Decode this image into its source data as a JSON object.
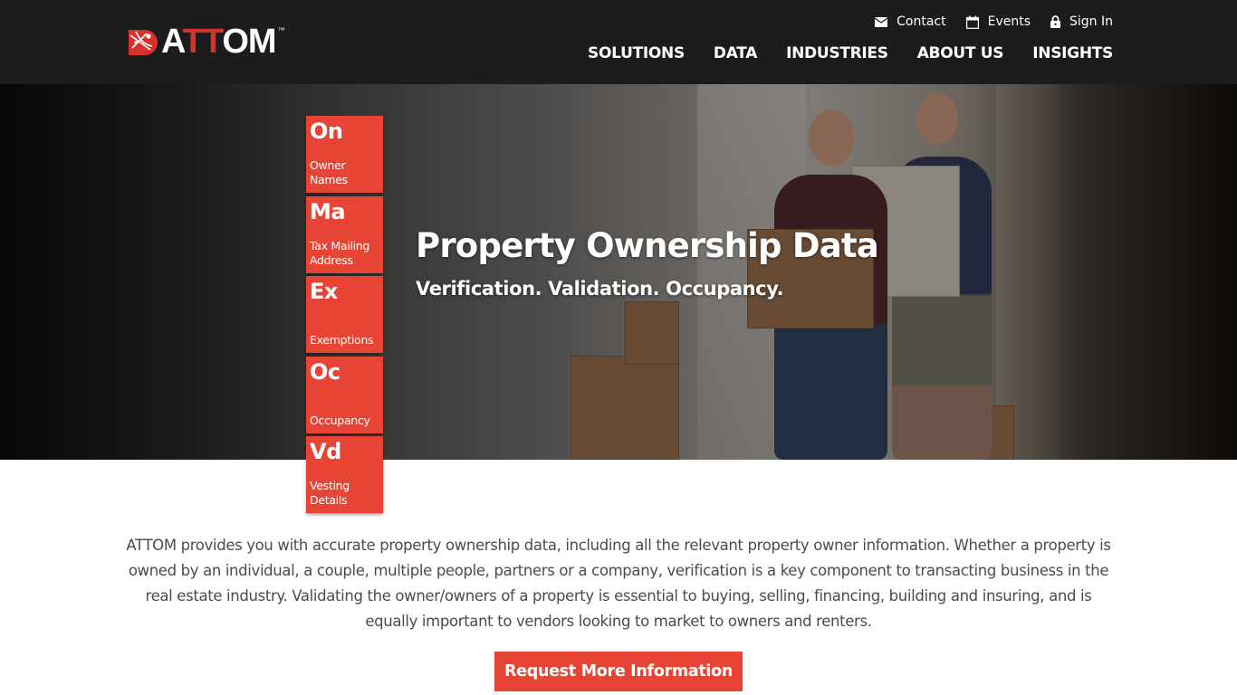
{
  "brand": {
    "name_prefix": "A",
    "name_red": "TT",
    "name_suffix": "OM",
    "trademark": "™",
    "accent_color": "#e84435"
  },
  "utility_nav": [
    {
      "icon": "envelope-icon",
      "label": "Contact"
    },
    {
      "icon": "calendar-icon",
      "label": "Events"
    },
    {
      "icon": "lock-icon",
      "label": "Sign In"
    }
  ],
  "main_nav": [
    {
      "label": "SOLUTIONS"
    },
    {
      "label": "DATA"
    },
    {
      "label": "INDUSTRIES"
    },
    {
      "label": "ABOUT US"
    },
    {
      "label": "INSIGHTS"
    }
  ],
  "hero": {
    "title": "Property Ownership Data",
    "subtitle": "Verification. Validation. Occupancy."
  },
  "tiles": [
    {
      "symbol": "On",
      "label": "Owner Names"
    },
    {
      "symbol": "Ma",
      "label": "Tax Mailing Address"
    },
    {
      "symbol": "Ex",
      "label": "Exemptions"
    },
    {
      "symbol": "Oc",
      "label": "Occupancy"
    },
    {
      "symbol": "Vd",
      "label": "Vesting Details"
    }
  ],
  "intro": {
    "text": "ATTOM provides you with accurate property ownership data, including all the relevant property owner information. Whether a property is owned by an individual, a couple, multiple people, partners or a company, verification is a key component to transacting business in the real estate industry. Validating the owner/owners of a property is essential to buying, selling, financing, building and insuring, and is equally important to vendors looking to market to owners and renters."
  },
  "cta": {
    "label": "Request More Information"
  }
}
